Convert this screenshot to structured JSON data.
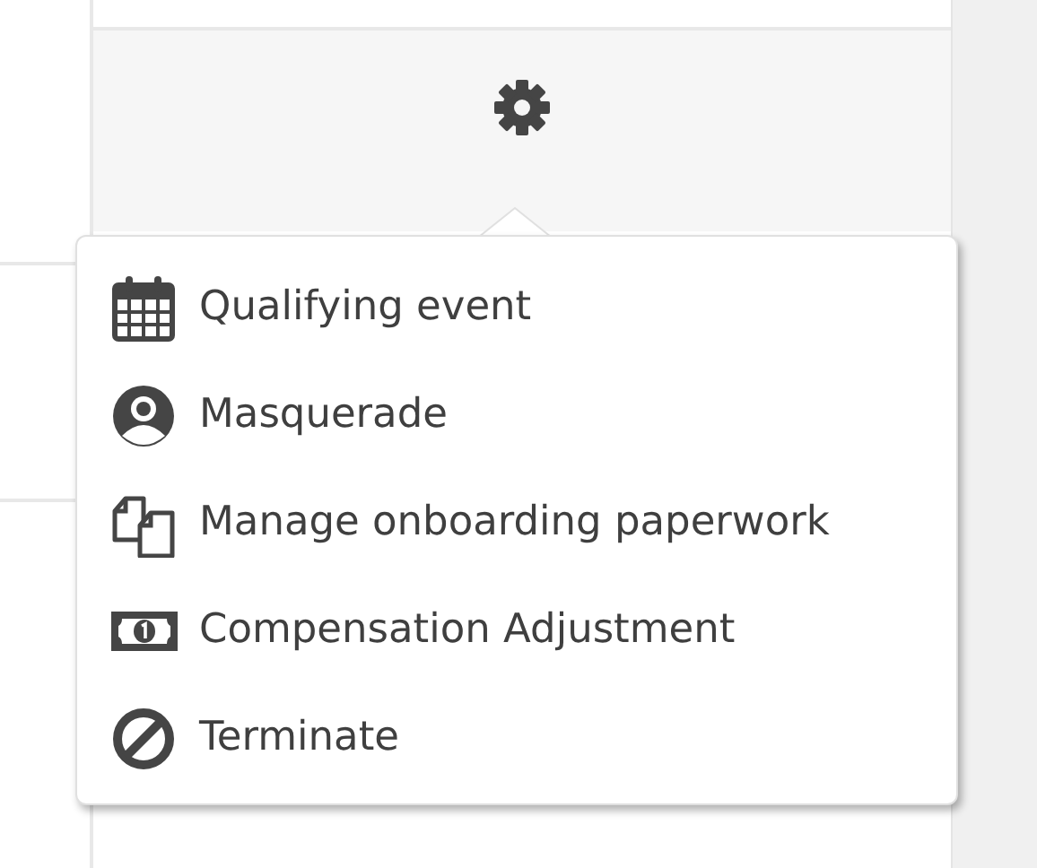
{
  "menu": {
    "items": [
      {
        "kind": "calendar",
        "label": "Qualifying event"
      },
      {
        "kind": "user",
        "label": "Masquerade"
      },
      {
        "kind": "documents",
        "label": "Manage onboarding paperwork"
      },
      {
        "kind": "money",
        "label": "Compensation Adjustment"
      },
      {
        "kind": "ban",
        "label": "Terminate"
      }
    ]
  }
}
